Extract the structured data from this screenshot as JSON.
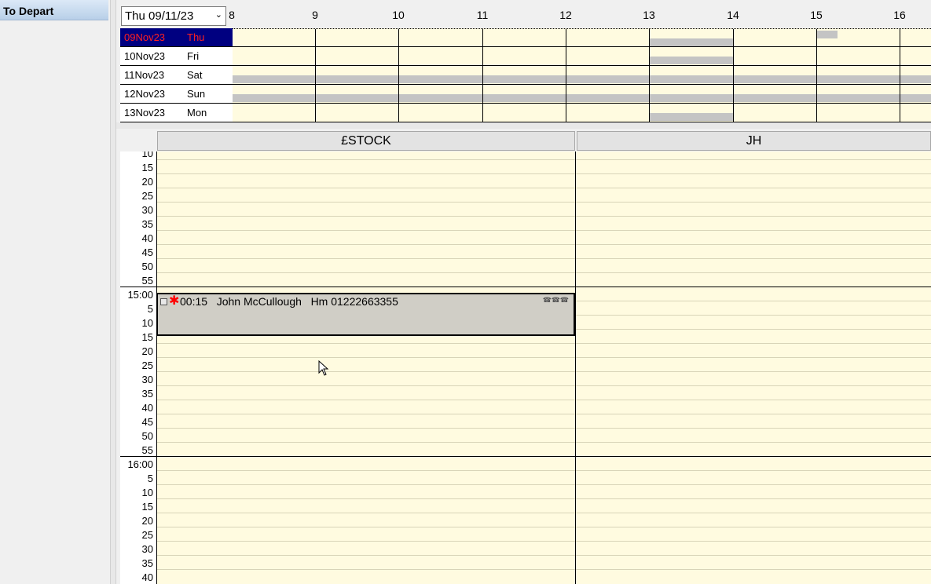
{
  "sidebar": {
    "button_label": "To Depart"
  },
  "date_selector": {
    "value": "Thu  09/11/23"
  },
  "overview": {
    "hours": [
      "8",
      "9",
      "10",
      "11",
      "12",
      "13",
      "14",
      "15",
      "16"
    ],
    "days": [
      {
        "date": "09Nov23",
        "day": "Thu",
        "selected": true
      },
      {
        "date": "10Nov23",
        "day": "Fri",
        "selected": false
      },
      {
        "date": "11Nov23",
        "day": "Sat",
        "selected": false
      },
      {
        "date": "12Nov23",
        "day": "Sun",
        "selected": false
      },
      {
        "date": "13Nov23",
        "day": "Mon",
        "selected": false
      }
    ]
  },
  "columns": [
    {
      "label": "£STOCK"
    },
    {
      "label": "JH"
    }
  ],
  "time_labels": [
    "10",
    "15",
    "20",
    "25",
    "30",
    "35",
    "40",
    "45",
    "50",
    "55",
    "15:00",
    "5",
    "10",
    "15",
    "20",
    "25",
    "30",
    "35",
    "40",
    "45",
    "50",
    "55",
    "16:00",
    "5",
    "10",
    "15",
    "20",
    "25",
    "30",
    "35",
    "40"
  ],
  "appointment": {
    "duration": "00:15",
    "name": "John McCullough",
    "phone": "Hm 01222663355",
    "icons": [
      "phone-icon",
      "phone-icon",
      "phone-icon"
    ]
  },
  "colors": {
    "grid_bg": "#fffbe0",
    "selected_row": "#000080",
    "busy": "#c4c4c4"
  }
}
